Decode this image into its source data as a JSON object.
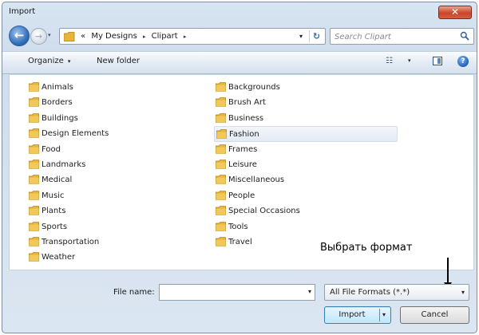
{
  "window": {
    "title": "Import",
    "close_glyph": "✕"
  },
  "nav": {
    "back_glyph": "←",
    "forward_glyph": "→",
    "history_glyph": "▾",
    "breadcrumb_prefix": "«",
    "breadcrumbs": [
      "My Designs",
      "Clipart"
    ],
    "breadcrumb_separator": "▸",
    "address_dropdown_glyph": "▾",
    "refresh_glyph": "↻",
    "search_placeholder": "Search Clipart"
  },
  "toolbar": {
    "organize_label": "Organize",
    "organize_caret": "▾",
    "new_folder_label": "New folder",
    "views_glyph": "☷",
    "views_caret": "▾",
    "help_glyph": "?"
  },
  "folders": {
    "left": [
      "Animals",
      "Borders",
      "Buildings",
      "Design Elements",
      "Food",
      "Landmarks",
      "Medical",
      "Music",
      "Plants",
      "Sports",
      "Transportation",
      "Weather"
    ],
    "right": [
      "Backgrounds",
      "Brush Art",
      "Business",
      "Fashion",
      "Frames",
      "Leisure",
      "Miscellaneous",
      "People",
      "Special Occasions",
      "Tools",
      "Travel"
    ],
    "selected": "Fashion"
  },
  "bottom": {
    "file_name_label": "File name:",
    "file_name_value": "",
    "file_name_caret": "▾",
    "file_type_value": "All File Formats (*.*)",
    "file_type_caret": "▾",
    "import_label": "Import",
    "import_arrow": "▾",
    "cancel_label": "Cancel"
  },
  "annotation": {
    "text": "Выбрать формат"
  },
  "colors": {
    "folder": "#e8b53c",
    "selection": "#e2eaf4",
    "accent": "#2e6bb8"
  }
}
